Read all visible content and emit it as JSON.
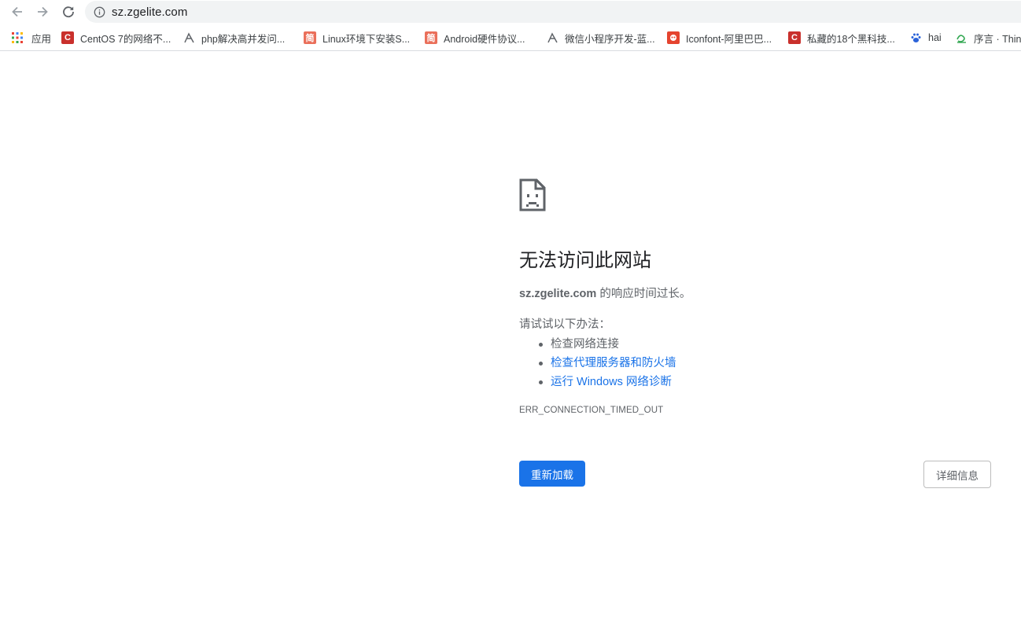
{
  "browser": {
    "url": "sz.zgelite.com",
    "bookmarks": [
      {
        "label": "应用",
        "icon": "apps-grid-icon"
      },
      {
        "label": "CentOS 7的网络不...",
        "icon": "csdn-icon"
      },
      {
        "label": "php解决高并发问...",
        "icon": "segmentfault-icon"
      },
      {
        "label": "Linux环境下安装S...",
        "icon": "jianshu-icon"
      },
      {
        "label": "Android硬件协议...",
        "icon": "jianshu-icon"
      },
      {
        "label": "微信小程序开发-蓝...",
        "icon": "segmentfault-icon"
      },
      {
        "label": "Iconfont-阿里巴巴...",
        "icon": "iconfont-icon"
      },
      {
        "label": "私藏的18个黑科技...",
        "icon": "csdn-icon"
      },
      {
        "label": "hai",
        "icon": "baidu-paw-icon"
      },
      {
        "label": "序言 · Thin",
        "icon": "thinkphp-icon"
      }
    ]
  },
  "error": {
    "title": "无法访问此网站",
    "host": "sz.zgelite.com",
    "desc_suffix": " 的响应时间过长。",
    "suggest_label": "请试试以下办法：",
    "suggestions": [
      {
        "text": "检查网络连接",
        "link": false
      },
      {
        "text": "检查代理服务器和防火墙",
        "link": true
      },
      {
        "text": "运行 Windows 网络诊断",
        "link": true
      }
    ],
    "code": "ERR_CONNECTION_TIMED_OUT",
    "reload_label": "重新加载",
    "details_label": "详细信息"
  },
  "colors": {
    "accent": "#1a73e8",
    "text_secondary": "#5f6368",
    "omnibox_bg": "#f1f3f4"
  }
}
